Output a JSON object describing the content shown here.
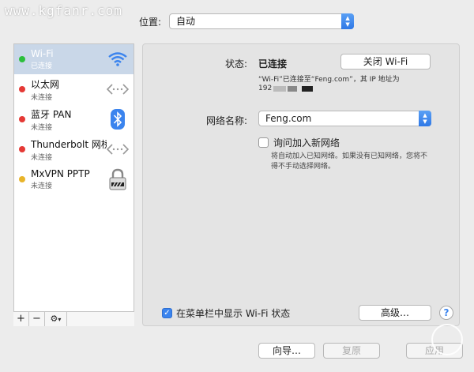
{
  "watermark": "www.kgfanr.com",
  "location": {
    "label": "位置:",
    "value": "自动"
  },
  "services": [
    {
      "name": "Wi-Fi",
      "status": "已连接",
      "dot_color": "#2bbf3b",
      "selected": true,
      "icon": "wifi-icon"
    },
    {
      "name": "以太网",
      "status": "未连接",
      "dot_color": "#e53935",
      "selected": false,
      "icon": "ethernet-icon"
    },
    {
      "name": "蓝牙 PAN",
      "status": "未连接",
      "dot_color": "#e53935",
      "selected": false,
      "icon": "bluetooth-icon"
    },
    {
      "name": "Thunderbolt 网桥",
      "status": "未连接",
      "dot_color": "#e53935",
      "selected": false,
      "icon": "thunderbolt-bridge-icon"
    },
    {
      "name": "MxVPN PPTP",
      "status": "未连接",
      "dot_color": "#e8b42a",
      "selected": false,
      "icon": "vpn-lock-icon"
    }
  ],
  "sidebar_tools": {
    "add": "+",
    "remove": "−",
    "gear": "⚙︎"
  },
  "detail": {
    "status_label": "状态:",
    "status_value": "已连接",
    "turn_off_button": "关闭 Wi-Fi",
    "status_desc_line1": "“Wi-Fi”已连接至“Feng.com”，其 IP 地址为",
    "ip_prefix": "192",
    "network_label": "网络名称:",
    "network_value": "Feng.com",
    "ask_join_label": "询问加入新网络",
    "ask_join_checked": false,
    "ask_join_desc_line1": "将自动加入已知网络。如果没有已知网络，您将不",
    "ask_join_desc_line2": "得不手动选择网络。",
    "show_menubar_label": "在菜单栏中显示 Wi-Fi 状态",
    "show_menubar_checked": true,
    "advanced_button": "高级…",
    "help": "?"
  },
  "bottom": {
    "assist": "向导…",
    "revert": "复原",
    "apply": "应用"
  },
  "colors": {
    "accent": "#3b84ee",
    "selection": "#c9d7e8"
  }
}
